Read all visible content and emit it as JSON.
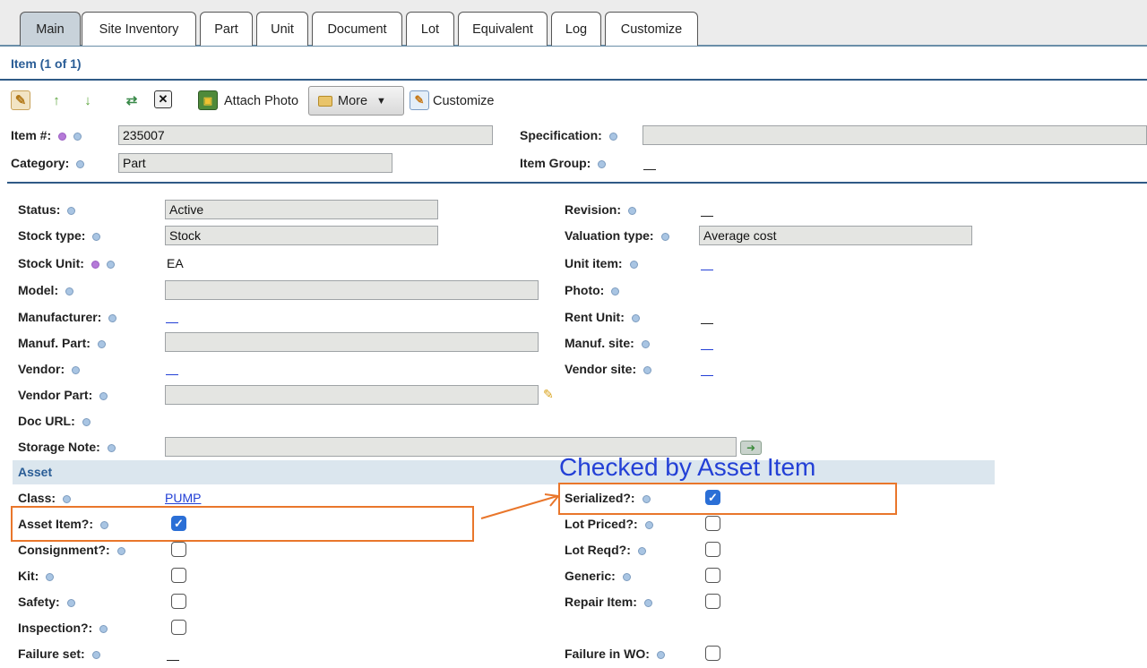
{
  "tabs": [
    "Main",
    "Site Inventory",
    "Part",
    "Unit",
    "Document",
    "Lot",
    "Equivalent",
    "Log",
    "Customize"
  ],
  "header": {
    "title": "Item (1 of 1)"
  },
  "toolbar": {
    "attach_photo": "Attach Photo",
    "more": "More",
    "customize": "Customize"
  },
  "top": {
    "item_label": "Item #:",
    "item_value": "235007",
    "category_label": "Category:",
    "category_value": "Part",
    "spec_label": "Specification:",
    "spec_value": "",
    "group_label": "Item Group:"
  },
  "left": {
    "status_label": "Status:",
    "status_value": "Active",
    "stock_type_label": "Stock type:",
    "stock_type_value": "Stock",
    "stock_unit_label": "Stock Unit:",
    "stock_unit_value": "EA",
    "model_label": "Model:",
    "manufacturer_label": "Manufacturer:",
    "manuf_part_label": "Manuf. Part:",
    "vendor_label": "Vendor:",
    "vendor_part_label": "Vendor Part:",
    "doc_url_label": "Doc URL:",
    "storage_note_label": "Storage Note:"
  },
  "right": {
    "revision_label": "Revision:",
    "valuation_label": "Valuation type:",
    "valuation_value": "Average cost",
    "unit_item_label": "Unit item:",
    "photo_label": "Photo:",
    "rent_unit_label": "Rent Unit:",
    "manuf_site_label": "Manuf. site:",
    "vendor_site_label": "Vendor site:"
  },
  "asset": {
    "section_title": "Asset",
    "class_label": "Class:",
    "class_value": "PUMP",
    "asset_item_label": "Asset Item?:",
    "consignment_label": "Consignment?:",
    "kit_label": "Kit:",
    "safety_label": "Safety:",
    "inspection_label": "Inspection?:",
    "failure_set_label": "Failure set:",
    "serialized_label": "Serialized?:",
    "lot_priced_label": "Lot Priced?:",
    "lot_reqd_label": "Lot Reqd?:",
    "generic_label": "Generic:",
    "repair_item_label": "Repair Item:",
    "failure_wo_label": "Failure in WO:"
  },
  "annotation": {
    "text": "Checked by Asset Item"
  },
  "colors": {
    "accent": "#2a5d96",
    "highlight": "#e9762b",
    "annotation": "#2340d6",
    "check": "#2b6fd6"
  }
}
